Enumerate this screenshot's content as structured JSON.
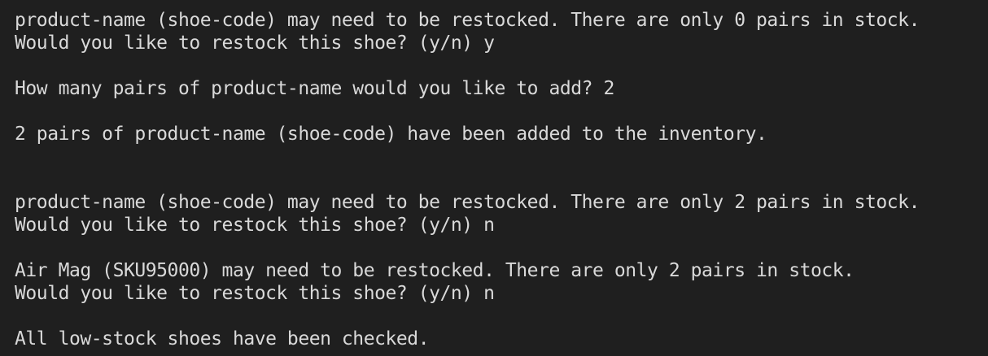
{
  "terminal": {
    "lines": [
      "product-name (shoe-code) may need to be restocked. There are only 0 pairs in stock.",
      "Would you like to restock this shoe? (y/n) y",
      "",
      "How many pairs of product-name would you like to add? 2",
      "",
      "2 pairs of product-name (shoe-code) have been added to the inventory.",
      "",
      "",
      "product-name (shoe-code) may need to be restocked. There are only 2 pairs in stock.",
      "Would you like to restock this shoe? (y/n) n",
      "",
      "Air Mag (SKU95000) may need to be restocked. There are only 2 pairs in stock.",
      "Would you like to restock this shoe? (y/n) n",
      "",
      "All low-stock shoes have been checked."
    ]
  }
}
